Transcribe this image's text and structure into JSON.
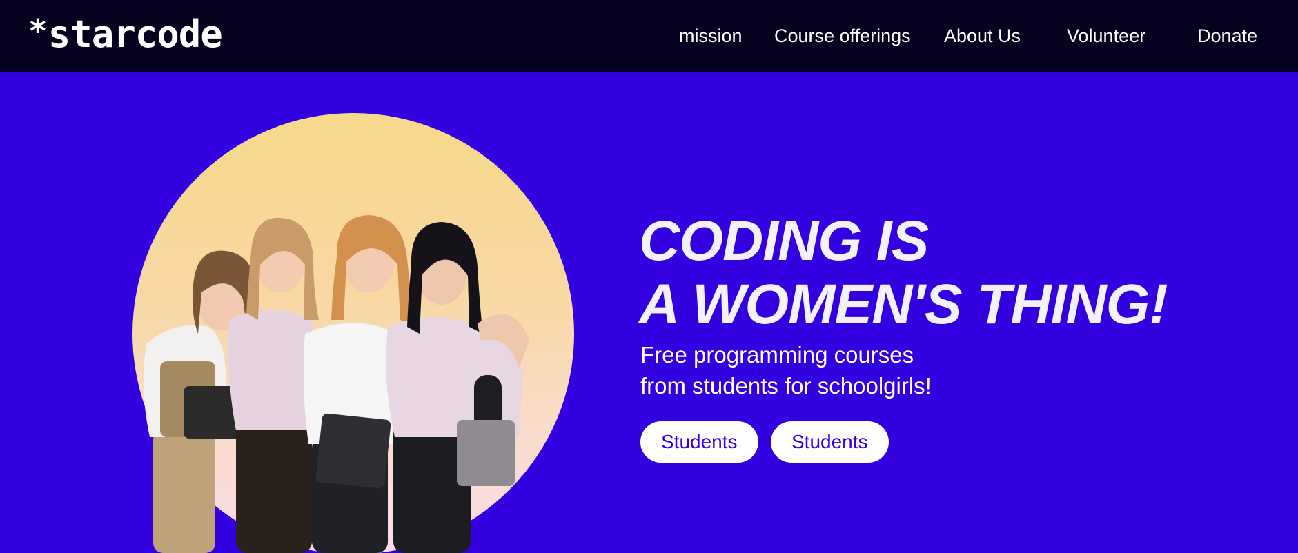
{
  "header": {
    "logo_text": "starcode",
    "logo_star": "*",
    "nav": [
      {
        "label": "mission"
      },
      {
        "label": "Course offerings"
      },
      {
        "label": "About Us"
      },
      {
        "label": "Volunteer"
      },
      {
        "label": "Donate"
      }
    ]
  },
  "hero": {
    "headline_line1": "CODING IS",
    "headline_line2": "A WOMEN'S THING!",
    "subtitle_line1": "Free programming courses",
    "subtitle_line2": "from students for schoolgirls!",
    "buttons": [
      {
        "label": "Students"
      },
      {
        "label": "Students"
      }
    ],
    "image_icon": "group-photo-four-girls"
  },
  "colors": {
    "nav_background": "#05021f",
    "hero_background": "#3300e0",
    "button_background": "#ffffff",
    "button_text": "#3300e0",
    "circle_top": "#f6d98a",
    "circle_bottom": "#fbdcea"
  }
}
